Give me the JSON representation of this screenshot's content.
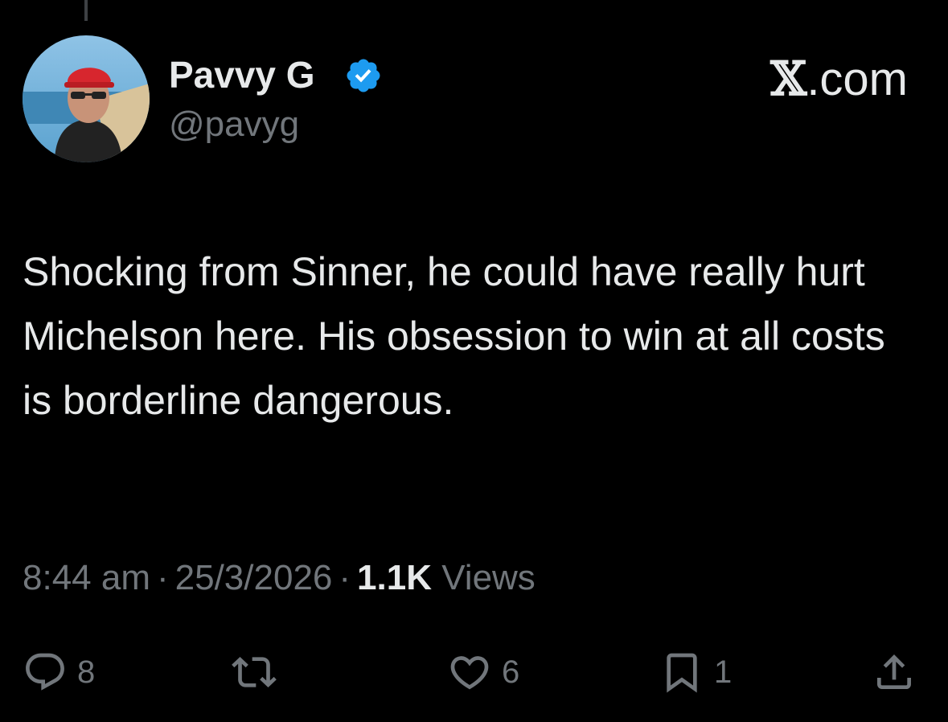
{
  "author": {
    "display_name": "Pavvy G",
    "handle": "@pavyg",
    "verified_icon": "verified-badge-icon",
    "avatar_icon": "avatar"
  },
  "brand": {
    "x_mark": "𝕏",
    "text": ".com"
  },
  "tweet": {
    "text": "Shocking from Sinner, he could have really hurt Michelson here. His obsession to win at all costs is borderline dangerous."
  },
  "meta": {
    "time": "8:44 am",
    "date": "25/3/2026",
    "views_count": "1.1K",
    "views_label": "Views",
    "separator": "·"
  },
  "actions": {
    "reply_count": "8",
    "like_count": "6",
    "bookmark_count": "1"
  },
  "colors": {
    "background": "#000000",
    "text": "#e7e9ea",
    "secondary": "#71767b",
    "verified": "#1d9bf0"
  }
}
